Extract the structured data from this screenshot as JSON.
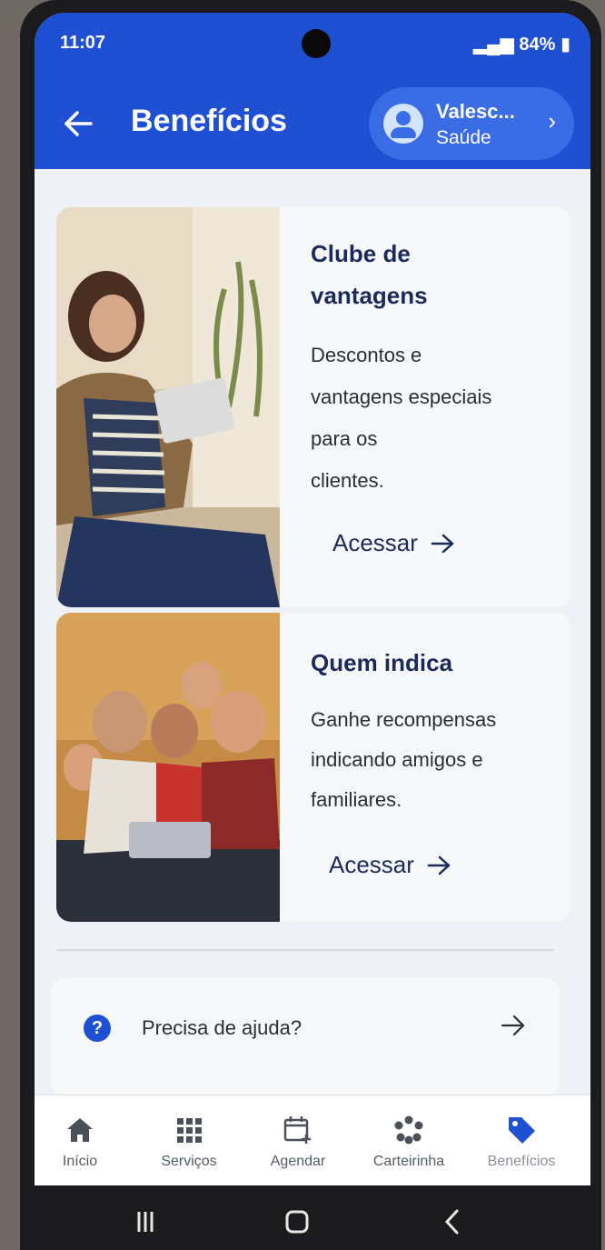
{
  "status_bar": {
    "time": "11:07",
    "battery": "84%"
  },
  "header": {
    "title": "Benefícios",
    "profile_name": "Valesc...",
    "profile_subtitle": "Saúde"
  },
  "cards": [
    {
      "title_line1": "Clube de",
      "title_line2": "vantagens",
      "desc_lines": [
        "Descontos e",
        "vantagens especiais",
        "para os",
        "clientes."
      ],
      "action_label": "Acessar"
    },
    {
      "title_line1": "Quem indica",
      "desc_lines": [
        "Ganhe recompensas",
        "indicando amigos e",
        "familiares."
      ],
      "action_label": "Acessar"
    }
  ],
  "help": {
    "label": "Precisa de ajuda?"
  },
  "bottom_nav": {
    "items": [
      {
        "label": "Início",
        "icon": "home-icon"
      },
      {
        "label": "Serviços",
        "icon": "grid-icon"
      },
      {
        "label": "Agendar",
        "icon": "calendar-add-icon"
      },
      {
        "label": "Carteirinha",
        "icon": "flower-icon"
      },
      {
        "label": "Benefícios",
        "icon": "tag-icon"
      }
    ]
  },
  "colors": {
    "brand_blue": "#1f4fd3",
    "dark_navy": "#1b2a5a"
  }
}
